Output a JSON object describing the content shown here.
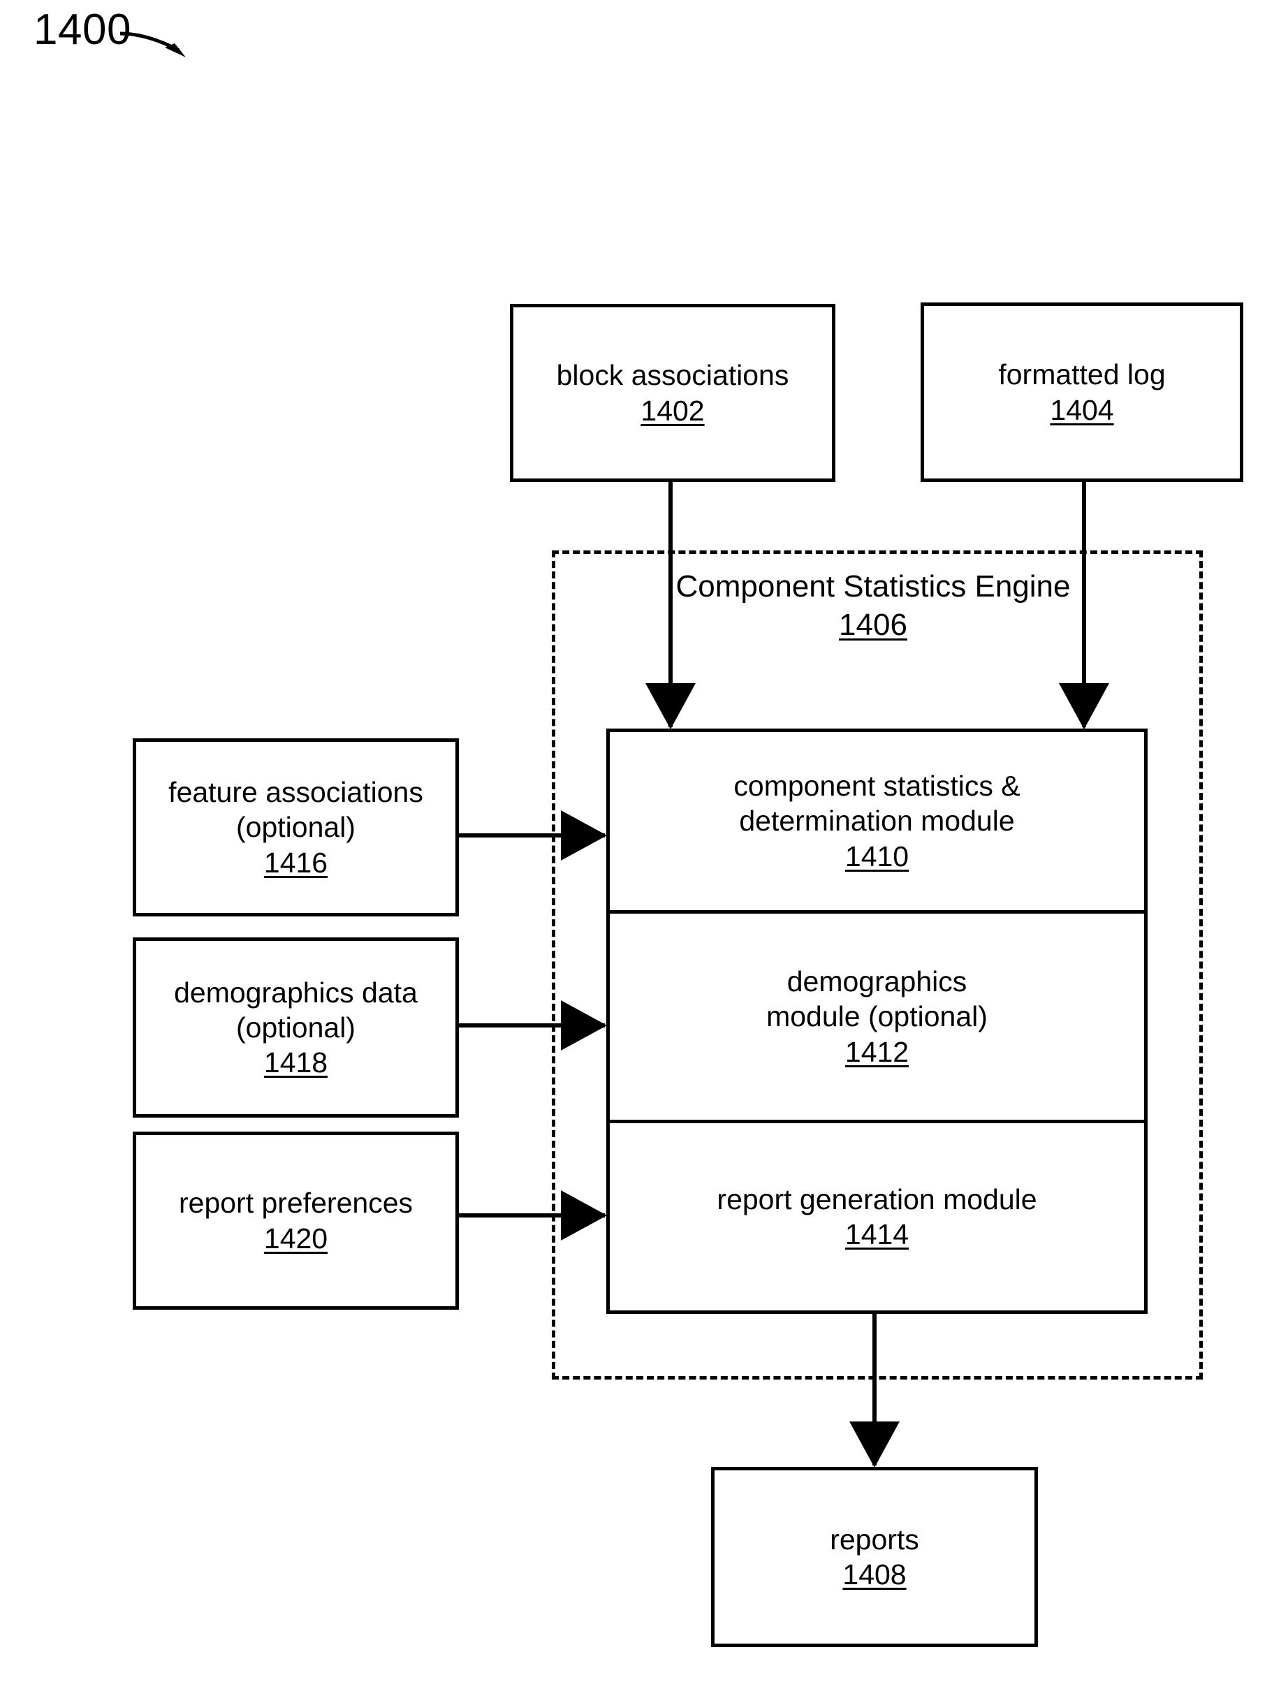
{
  "figure": {
    "number": "1400",
    "lead_arrow": "curved-arrow-icon"
  },
  "boxes": {
    "block_associations": {
      "label": "block associations",
      "ref": "1402"
    },
    "formatted_log": {
      "label": "formatted log",
      "ref": "1404"
    },
    "feature_associations": {
      "label": "feature associations",
      "sublabel": "(optional)",
      "ref": "1416"
    },
    "demographics_data": {
      "label": "demographics data",
      "sublabel": "(optional)",
      "ref": "1418"
    },
    "report_preferences": {
      "label": "report preferences",
      "ref": "1420"
    },
    "reports": {
      "label": "reports",
      "ref": "1408"
    }
  },
  "engine": {
    "title_line1": "Component Statistics",
    "title_line2": "Engine",
    "ref": "1406",
    "modules": {
      "statistics": {
        "line1": "component statistics &",
        "line2": "determination module",
        "ref": "1410"
      },
      "demographics": {
        "line1": "demographics",
        "line2": "module (optional)",
        "ref": "1412"
      },
      "report_generation": {
        "line1": "report generation module",
        "ref": "1414"
      }
    }
  },
  "connectors": [
    {
      "name": "block-associations-to-statistics-module",
      "from": "1402",
      "to": "1410"
    },
    {
      "name": "formatted-log-to-statistics-module",
      "from": "1404",
      "to": "1410"
    },
    {
      "name": "feature-associations-to-statistics-module",
      "from": "1416",
      "to": "1410"
    },
    {
      "name": "demographics-data-to-demographics-module",
      "from": "1418",
      "to": "1412"
    },
    {
      "name": "report-preferences-to-report-generation-module",
      "from": "1420",
      "to": "1414"
    },
    {
      "name": "report-generation-module-to-reports",
      "from": "1414",
      "to": "1408"
    }
  ],
  "colors": {
    "stroke": "#000000",
    "background": "#ffffff"
  }
}
